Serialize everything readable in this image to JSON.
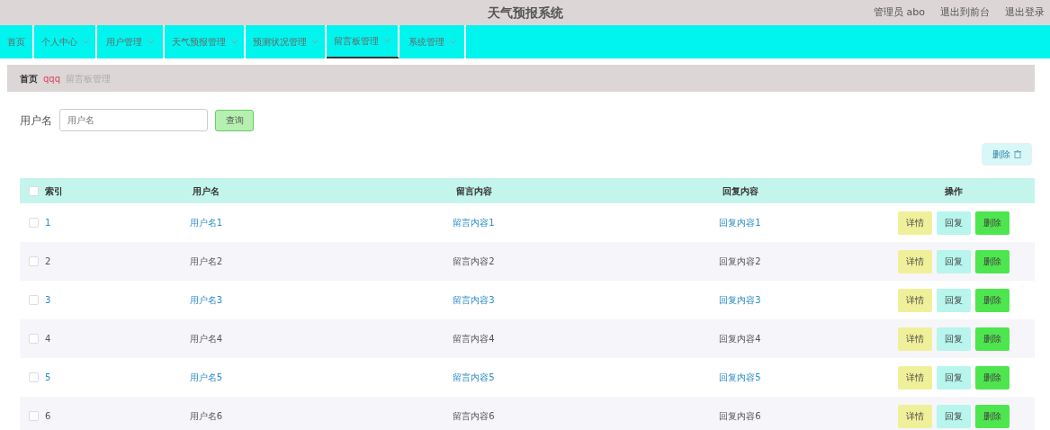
{
  "header": {
    "title": "天气预报系统",
    "links": [
      "管理员 abo",
      "退出到前台",
      "退出登录"
    ]
  },
  "nav": [
    {
      "label": "首页",
      "dropdown": false,
      "selected": false
    },
    {
      "label": "个人中心",
      "dropdown": true,
      "selected": false
    },
    {
      "label": "用户管理",
      "dropdown": true,
      "selected": false
    },
    {
      "label": "天气预报管理",
      "dropdown": true,
      "selected": false
    },
    {
      "label": "预测状况管理",
      "dropdown": true,
      "selected": false
    },
    {
      "label": "留言板管理",
      "dropdown": true,
      "selected": true
    },
    {
      "label": "系统管理",
      "dropdown": true,
      "selected": false
    }
  ],
  "breadcrumb": [
    "首页",
    "qqq",
    "留言板管理"
  ],
  "search": {
    "label": "用户名",
    "placeholder": "用户名",
    "button": "查询"
  },
  "delete_button": "删除",
  "table": {
    "columns": [
      "索引",
      "用户名",
      "留言内容",
      "回复内容",
      "操作"
    ],
    "rows": [
      {
        "index": "1",
        "username": "用户名1",
        "message": "留言内容1",
        "reply": "回复内容1",
        "linked": true,
        "checked": false,
        "actions": [
          "详情",
          "回复",
          "删除"
        ]
      },
      {
        "index": "2",
        "username": "用户名2",
        "message": "留言内容2",
        "reply": "回复内容2",
        "linked": false,
        "checked": false,
        "actions": [
          "详情",
          "回复",
          "删除"
        ]
      },
      {
        "index": "3",
        "username": "用户名3",
        "message": "留言内容3",
        "reply": "回复内容3",
        "linked": true,
        "checked": false,
        "actions": [
          "详情",
          "回复",
          "删除"
        ]
      },
      {
        "index": "4",
        "username": "用户名4",
        "message": "留言内容4",
        "reply": "回复内容4",
        "linked": false,
        "checked": false,
        "actions": [
          "详情",
          "回复",
          "删除"
        ]
      },
      {
        "index": "5",
        "username": "用户名5",
        "message": "留言内容5",
        "reply": "回复内容5",
        "linked": true,
        "checked": false,
        "actions": [
          "详情",
          "回复",
          "删除"
        ]
      },
      {
        "index": "6",
        "username": "用户名6",
        "message": "留言内容6",
        "reply": "回复内容6",
        "linked": false,
        "checked": false,
        "actions": [
          "详情",
          "回复",
          "删除"
        ]
      }
    ],
    "select_all_checked": false
  }
}
